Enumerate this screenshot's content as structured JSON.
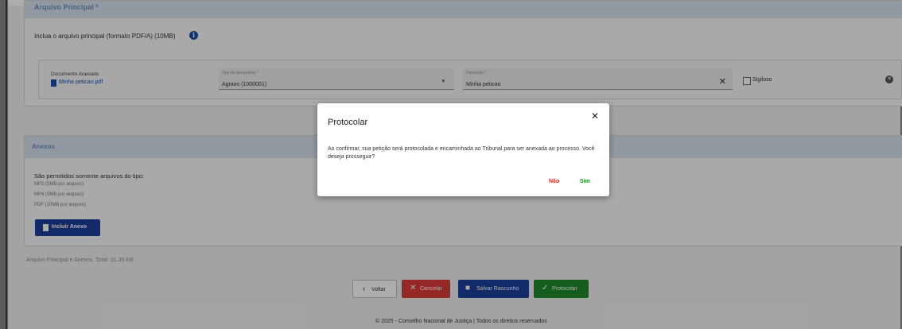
{
  "principal": {
    "title": "Arquivo Principal *",
    "instruction": "Inclua o arquivo principal (formato PDF/A) (10MB)",
    "document_label": "Documento Anexado",
    "document_link": "Minha peticao.pdf",
    "tipo_label": "Tipo de documento *",
    "tipo_value": "Agravo (1000001)",
    "descricao_label": "Descrição *",
    "descricao_value": "Minha peticao",
    "sigilo_label": "Sigiloso"
  },
  "anexos": {
    "title": "Anexos",
    "permitidos": "São permitidos somente arquivos do tipo:",
    "formats": [
      "MP3 (5MB por arquivo)",
      "MP4 (5MB por arquivo)",
      "PDF (10MB por arquivo)"
    ],
    "button_label": "Incluir Anexo"
  },
  "total": "Arquivo Principal e Anexos. Total: 31.35 KB",
  "actions": {
    "voltar": "Voltar",
    "cancelar": "Cancelar",
    "rascunho": "Salvar Rascunho",
    "protocolar": "Protocolar"
  },
  "footer": "© 2025 - Conselho Nacional de Justiça | Todos os direitos reservados",
  "modal": {
    "title": "Protocolar",
    "body": "Ao confirmar, sua petição será protocolada e encaminhada ao Tribunal para ser anexada ao processo. Você deseja prosseguir?",
    "no": "Não",
    "yes": "Sim"
  },
  "icons": {
    "info": "info-icon",
    "pdf": "pdf-file-icon",
    "dropdown": "chevron-down-icon",
    "clear": "close-icon",
    "remove": "remove-circle-icon",
    "upload": "file-upload-icon",
    "voltar": "chevron-left-icon",
    "cancelar": "close-icon",
    "rascunho": "save-icon",
    "protocolar": "check-icon"
  },
  "colors": {
    "primary": "#1d3f9a",
    "danger": "#dd3a3a",
    "success": "#1f8a2c",
    "header_bg": "#d9e2ec"
  }
}
